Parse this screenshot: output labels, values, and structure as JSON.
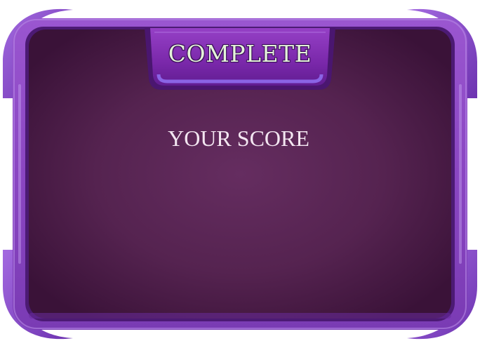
{
  "dialog": {
    "title": "COMPLETE",
    "score_label": "YOUR SCORE"
  },
  "colors": {
    "frame_purple": "#8f4cc6",
    "frame_dark": "#5a1c8c",
    "frame_light": "#b98de8",
    "panel_center": "#642c5e",
    "panel_edge": "#3b1238",
    "title_text": "#e4f3da",
    "score_text": "#f3e6f1"
  },
  "icons": {
    "corner_ornaments": "horn-ornament-icon"
  }
}
